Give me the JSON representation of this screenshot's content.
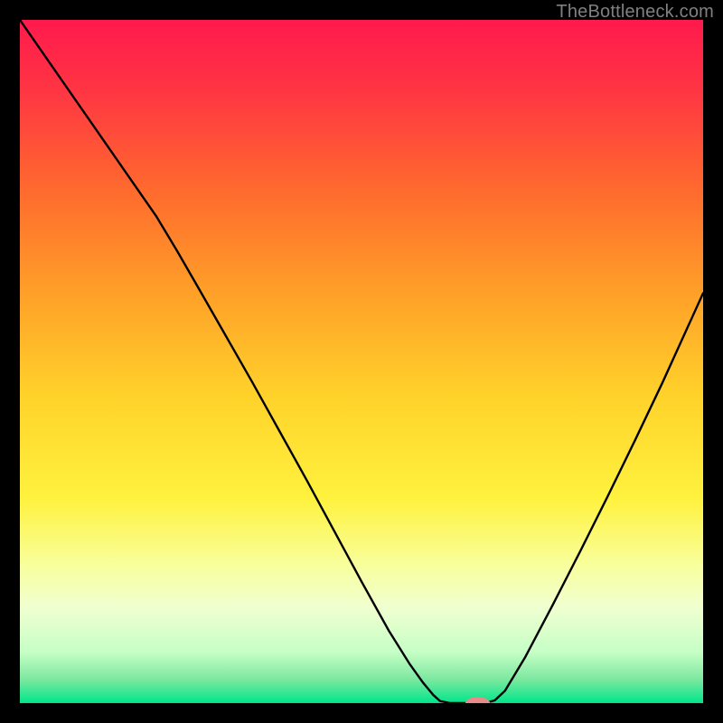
{
  "watermark": "TheBottleneck.com",
  "chart_data": {
    "type": "line",
    "title": "",
    "xlabel": "",
    "ylabel": "",
    "xlim": [
      0,
      1
    ],
    "ylim": [
      0,
      1
    ],
    "axes_visible": false,
    "background_gradient": {
      "stops": [
        {
          "offset": 0.0,
          "color": "#ff1a4d"
        },
        {
          "offset": 0.1,
          "color": "#ff3443"
        },
        {
          "offset": 0.25,
          "color": "#ff6a2e"
        },
        {
          "offset": 0.4,
          "color": "#ffa028"
        },
        {
          "offset": 0.55,
          "color": "#ffd22a"
        },
        {
          "offset": 0.7,
          "color": "#fff23e"
        },
        {
          "offset": 0.8,
          "color": "#f8ff9e"
        },
        {
          "offset": 0.86,
          "color": "#f0ffd0"
        },
        {
          "offset": 0.925,
          "color": "#c6ffc6"
        },
        {
          "offset": 0.965,
          "color": "#7de8a0"
        },
        {
          "offset": 1.0,
          "color": "#00e68a"
        }
      ]
    },
    "curve": {
      "points": [
        {
          "x": 0.0,
          "y": 1.0
        },
        {
          "x": 0.05,
          "y": 0.928
        },
        {
          "x": 0.1,
          "y": 0.856
        },
        {
          "x": 0.15,
          "y": 0.784
        },
        {
          "x": 0.2,
          "y": 0.712
        },
        {
          "x": 0.23,
          "y": 0.662
        },
        {
          "x": 0.26,
          "y": 0.61
        },
        {
          "x": 0.3,
          "y": 0.54
        },
        {
          "x": 0.34,
          "y": 0.47
        },
        {
          "x": 0.38,
          "y": 0.398
        },
        {
          "x": 0.42,
          "y": 0.326
        },
        {
          "x": 0.46,
          "y": 0.252
        },
        {
          "x": 0.5,
          "y": 0.178
        },
        {
          "x": 0.54,
          "y": 0.106
        },
        {
          "x": 0.57,
          "y": 0.058
        },
        {
          "x": 0.59,
          "y": 0.03
        },
        {
          "x": 0.605,
          "y": 0.012
        },
        {
          "x": 0.615,
          "y": 0.003
        },
        {
          "x": 0.63,
          "y": 0.0
        },
        {
          "x": 0.66,
          "y": 0.0
        },
        {
          "x": 0.68,
          "y": 0.0
        },
        {
          "x": 0.695,
          "y": 0.004
        },
        {
          "x": 0.71,
          "y": 0.018
        },
        {
          "x": 0.74,
          "y": 0.068
        },
        {
          "x": 0.78,
          "y": 0.144
        },
        {
          "x": 0.82,
          "y": 0.222
        },
        {
          "x": 0.86,
          "y": 0.302
        },
        {
          "x": 0.9,
          "y": 0.384
        },
        {
          "x": 0.94,
          "y": 0.468
        },
        {
          "x": 0.98,
          "y": 0.556
        },
        {
          "x": 1.0,
          "y": 0.6
        }
      ]
    },
    "marker": {
      "x": 0.67,
      "y": 0.0,
      "rx": 0.018,
      "ry": 0.009,
      "color": "#e88a8a"
    }
  }
}
